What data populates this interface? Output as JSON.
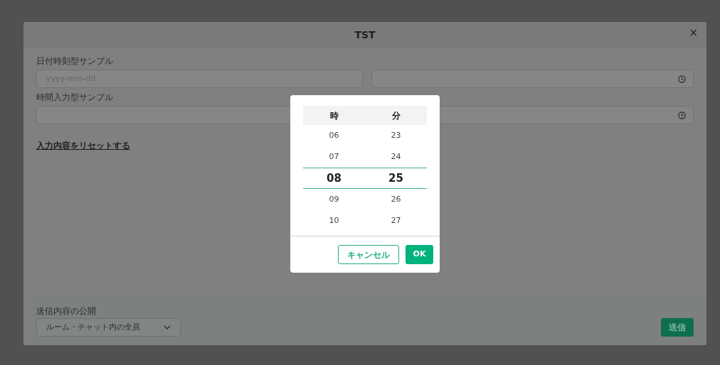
{
  "dialog": {
    "title": "TST",
    "close": "×"
  },
  "fields": [
    {
      "label": "日付時刻型サンプル",
      "date_placeholder": "yyyy-mm-dd"
    },
    {
      "label": "時間入力型サンプル"
    }
  ],
  "reset_link": "入力内容をリセットする",
  "visibility": {
    "label": "送信内容の公開",
    "value": "ルーム・チャット内の全員"
  },
  "submit": "送信",
  "picker": {
    "columns": [
      {
        "header": "時",
        "items": [
          {
            "label": "06",
            "selected": false
          },
          {
            "label": "07",
            "selected": false
          },
          {
            "label": "08",
            "selected": true
          },
          {
            "label": "09",
            "selected": false
          },
          {
            "label": "10",
            "selected": false
          }
        ]
      },
      {
        "header": "分",
        "items": [
          {
            "label": "23",
            "selected": false
          },
          {
            "label": "24",
            "selected": false
          },
          {
            "label": "25",
            "selected": true
          },
          {
            "label": "26",
            "selected": false
          },
          {
            "label": "27",
            "selected": false
          }
        ]
      }
    ],
    "cancel": "キャンセル",
    "ok": "OK"
  }
}
